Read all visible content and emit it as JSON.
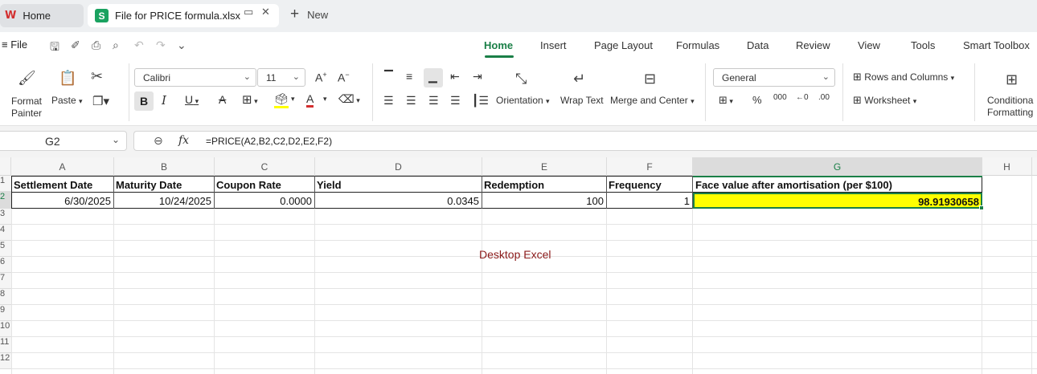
{
  "tabs": {
    "home_label": "Home",
    "home_logo": "W",
    "file_logo": "S",
    "file_title": "File for PRICE formula.xlsx",
    "new_label": "New"
  },
  "menu": {
    "file_label": "File",
    "items": [
      "Home",
      "Insert",
      "Page Layout",
      "Formulas",
      "Data",
      "Review",
      "View",
      "Tools",
      "Smart Toolbox"
    ]
  },
  "ribbon": {
    "format_painter": [
      "Format",
      "Painter"
    ],
    "paste_label": "Paste",
    "font_name": "Calibri",
    "font_size": "11",
    "orientation_label": "Orientation",
    "wrap_text_label": "Wrap Text",
    "merge_center_label": "Merge and Center",
    "number_format": "General",
    "rows_columns_label": "Rows and  Columns",
    "worksheet_label": "Worksheet",
    "conditional_formatting": [
      "Conditiona",
      "Formatting"
    ]
  },
  "formula_bar": {
    "name_box": "G2",
    "fx_symbol": "fx",
    "formula": "=PRICE(A2,B2,C2,D2,E2,F2)"
  },
  "grid": {
    "columns": [
      "A",
      "B",
      "C",
      "D",
      "E",
      "F",
      "G",
      "H"
    ],
    "row_numbers": [
      "1",
      "2",
      "3",
      "4",
      "5",
      "6",
      "7",
      "8",
      "9",
      "10",
      "11",
      "12"
    ],
    "header_row": [
      "Settlement Date",
      "Maturity Date",
      "Coupon Rate",
      "Yield",
      "Redemption",
      "Frequency",
      "Face value after amortisation (per $100)"
    ],
    "data_row": [
      "6/30/2025",
      "10/24/2025",
      "0.0000",
      "0.0345",
      "100",
      "1",
      "98.91930658"
    ],
    "watermark": "Desktop Excel"
  },
  "colors": {
    "accent": "#1a7f47",
    "selected_fill": "#ffff00",
    "watermark": "#8b1a1a"
  }
}
